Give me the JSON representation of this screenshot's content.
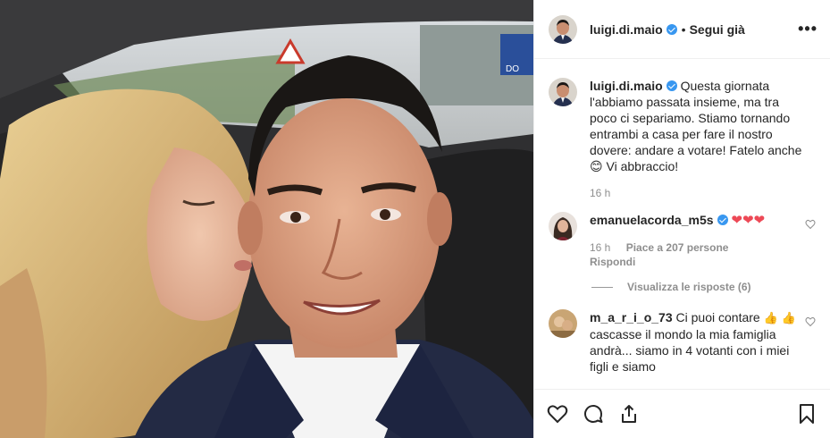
{
  "post": {
    "username": "luigi.di.maio",
    "separator": "•",
    "follow_label": "Segui già",
    "more_icon": "more-options-icon"
  },
  "caption": {
    "username": "luigi.di.maio",
    "text": "Questa giornata l'abbiamo passata insieme, ma tra poco ci separiamo. Stiamo tornando entrambi a casa per fare il nostro dovere: andare a votare! Fatelo anche",
    "emoji": "😊",
    "text_end": "Vi abbraccio!",
    "time": "16 h"
  },
  "comments": [
    {
      "username": "emanuelacorda_m5s",
      "text": "❤❤❤",
      "time": "16 h",
      "likes": "Piace a 207 persone",
      "reply_label": "Rispondi",
      "view_replies": "Visualizza le risposte (6)"
    },
    {
      "username": "m_a_r_i_o_73",
      "text_a": "Ci puoi contare",
      "thumb_a": "👍",
      "thumb_b": "👍",
      "text_b": "cascasse il mondo la mia famiglia andrà... siamo in 4 votanti con i miei figli e siamo"
    }
  ],
  "photo_sign": {
    "text": "DO"
  },
  "colors": {
    "accent": "#3897f0",
    "heart": "#ed4956",
    "muted": "#8e8e8e"
  }
}
